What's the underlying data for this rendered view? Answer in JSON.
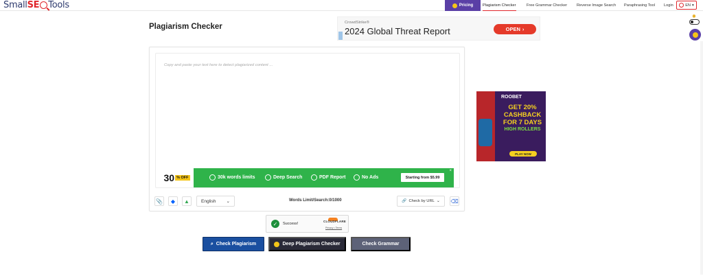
{
  "nav": {
    "logo_prefix": "Small",
    "logo_seo": "SE",
    "logo_suffix": "Tools",
    "pricing": "Pricing",
    "links": [
      "Plagiarism Checker",
      "Free Grammar Checker",
      "Reverse Image Search",
      "Paraphrasing Tool",
      "Login"
    ],
    "language": "EN"
  },
  "page_title": "Plagiarism Checker",
  "ad_top": {
    "brand": "CrowdStrike®",
    "headline": "2024 Global Threat Report",
    "cta": "OPEN"
  },
  "editor": {
    "placeholder": "Copy and paste your text here to detect plagiarized content ..."
  },
  "promo": {
    "discount_num": "30",
    "discount_pct": "% OFF",
    "features": [
      "30k words limits",
      "Deep Search",
      "PDF Report",
      "No Ads"
    ],
    "price_cta": "Starting from $5.99",
    "close": "×"
  },
  "toolbar": {
    "language": "English",
    "word_limit": "Words Limit/Search:0/1000",
    "check_url": "Check by URL"
  },
  "captcha": {
    "status": "Success!",
    "provider": "CLOUDFLARE",
    "links": "Privacy • Terms"
  },
  "buttons": {
    "check_plagiarism": "Check Plagiarism",
    "deep_check": "Deep Plagiarism Checker",
    "check_grammar": "Check Grammar"
  },
  "ad_side": {
    "brand": "ROOBET",
    "offer": "GET 20% CASHBACK FOR 7 DAYS",
    "game": "HIGH ROLLERS",
    "cta": "PLAY NOW"
  },
  "colors": {
    "accent": "#5a3fa6",
    "primary_button": "#1a4fa0",
    "promo_green": "#2fb34a",
    "brand_red": "#e0262b"
  },
  "icons": [
    "crown-icon",
    "globe-icon",
    "sun-icon",
    "paperclip-icon",
    "dropbox-icon",
    "google-drive-icon",
    "link-icon",
    "eraser-icon",
    "search-icon",
    "checkmark-icon"
  ]
}
